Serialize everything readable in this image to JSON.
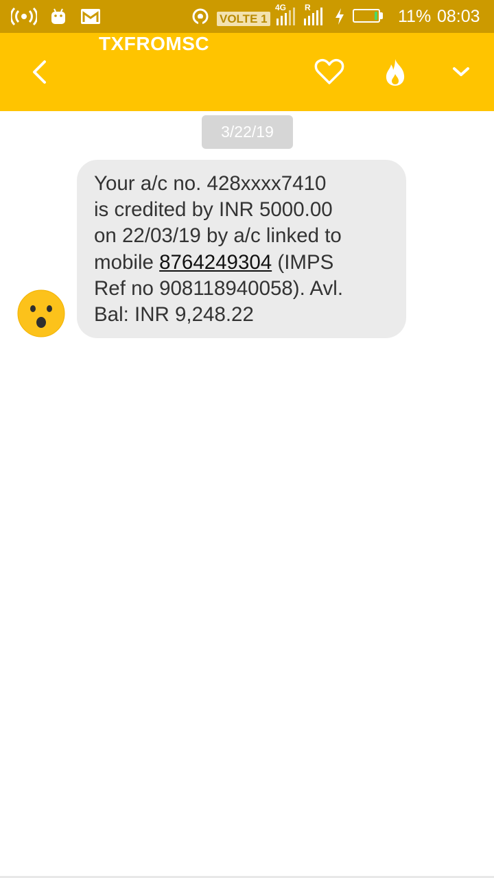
{
  "status_bar": {
    "network_type": "4G",
    "roaming_flag": "R",
    "volte_label": "VOLTE 1",
    "battery_percent_text": "11%",
    "battery_level": 0.11,
    "time": "08:03",
    "background_color": "#cc9a00",
    "icons": [
      "hotspot-icon",
      "android-icon",
      "gmail-icon",
      "wifi-calling-icon",
      "signal-sim1-icon",
      "signal-sim2-icon",
      "charging-icon",
      "battery-icon"
    ]
  },
  "toolbar": {
    "title": "TXFROMSC",
    "background_color": "#ffc400",
    "icons": [
      "back-arrow-icon",
      "heart-icon",
      "flame-icon",
      "chevron-down-icon"
    ]
  },
  "conversation": {
    "date_label": "3/22/19",
    "messages": [
      {
        "lines": [
          "Your a/c no. 428xxxx7410",
          "is credited by INR 5000.00",
          "on 22/03/19 by a/c linked to"
        ],
        "line4_prefix": "mobile ",
        "phone_link": "8764249304",
        "line4_suffix": " (IMPS",
        "line5": "Ref no 908118940058). Avl.",
        "line6": "Bal: INR 9,248.22",
        "avatar_icon": "surprised-face-icon"
      }
    ]
  }
}
